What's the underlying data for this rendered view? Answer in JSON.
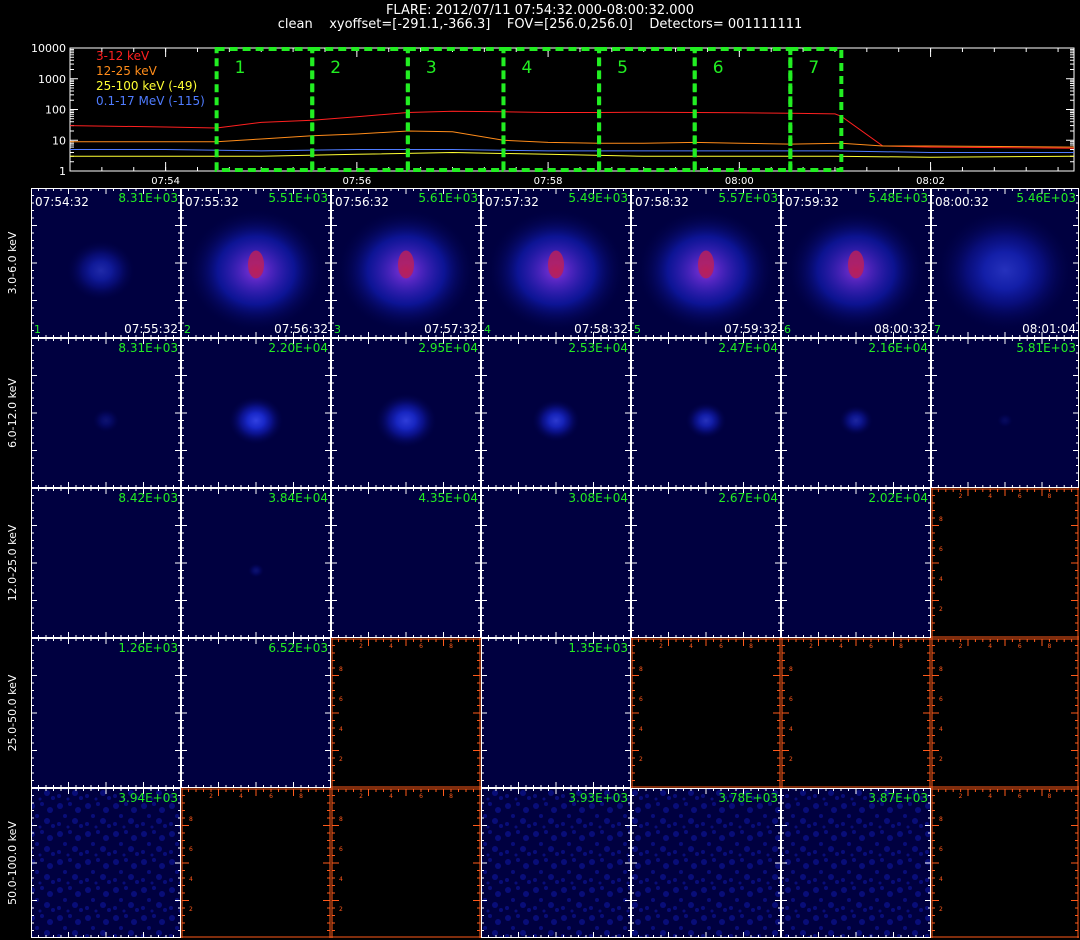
{
  "header": {
    "title": "FLARE: 2012/07/11 07:54:32.000-08:00:32.000",
    "subtitle": "clean    xyoffset=[-291.1,-366.3]    FOV=[256.0,256.0]    Detectors= 001111111"
  },
  "colors": {
    "band_3_12": "#ff2020",
    "band_12_25": "#ff8c1a",
    "band_25_100": "#ffff33",
    "band_100k": "#4f7cff",
    "box": "#22ee22",
    "peak_label": "#22ee22",
    "empty_axes": "#ff5a1a",
    "image_axes": "#ffffff"
  },
  "chart_data": [
    {
      "type": "line",
      "yscale": "log",
      "ylim": [
        1,
        10000
      ],
      "xlim": [
        "07:53:00",
        "08:03:30"
      ],
      "y_tick_labels": [
        "1",
        "10",
        "100",
        "1000",
        "10000"
      ],
      "x_tick_labels": [
        "07:54",
        "07:56",
        "07:58",
        "08:00",
        "08:02"
      ],
      "series": [
        {
          "name": "3-12 keV",
          "color": "#ff2020",
          "x": [
            "07:53:00",
            "07:54:00",
            "07:54:32",
            "07:55:00",
            "07:55:32",
            "07:56:00",
            "07:56:32",
            "07:57:00",
            "07:57:32",
            "07:58:00",
            "07:58:32",
            "07:59:00",
            "07:59:32",
            "08:00:00",
            "08:00:32",
            "08:01:00",
            "08:01:04",
            "08:01:30",
            "08:02:00",
            "08:03:30"
          ],
          "y": [
            30,
            27,
            25,
            38,
            45,
            58,
            80,
            88,
            84,
            80,
            80,
            82,
            80,
            78,
            76,
            72,
            60,
            6.5,
            6,
            5.5
          ]
        },
        {
          "name": "12-25 keV",
          "color": "#ff8c1a",
          "x": [
            "07:53:00",
            "07:54:32",
            "07:55:00",
            "07:55:32",
            "07:56:00",
            "07:56:32",
            "07:57:00",
            "07:57:32",
            "07:58:00",
            "07:58:32",
            "07:59:00",
            "07:59:32",
            "08:00:00",
            "08:00:32",
            "08:01:04",
            "08:01:30",
            "08:02:00",
            "08:03:30"
          ],
          "y": [
            9,
            9,
            11,
            14,
            16,
            20,
            19,
            10,
            8.5,
            8,
            8,
            8.5,
            8,
            7.5,
            8,
            6.5,
            6.5,
            6
          ]
        },
        {
          "name": "25-100 keV (-49)",
          "color": "#ffff33",
          "x": [
            "07:53:00",
            "07:54:00",
            "07:55:00",
            "07:56:00",
            "07:57:00",
            "07:58:00",
            "07:59:00",
            "08:00:00",
            "08:01:00",
            "08:02:00",
            "08:03:30"
          ],
          "y": [
            3,
            3,
            3,
            3.5,
            4,
            3.5,
            3,
            3,
            3,
            2.8,
            3
          ]
        },
        {
          "name": "0.1-17 MeV (-115)",
          "color": "#4f7cff",
          "x": [
            "07:53:00",
            "07:54:00",
            "07:55:00",
            "07:56:00",
            "07:57:00",
            "07:58:00",
            "07:59:00",
            "08:00:00",
            "08:01:00",
            "08:02:00",
            "08:03:30"
          ],
          "y": [
            5,
            5,
            4.5,
            5,
            5,
            4.5,
            4.5,
            4.5,
            4.5,
            4,
            4
          ]
        }
      ],
      "intervals": [
        {
          "label": "1",
          "start": "07:54:32",
          "end": "07:55:32"
        },
        {
          "label": "2",
          "start": "07:55:32",
          "end": "07:56:32"
        },
        {
          "label": "3",
          "start": "07:56:32",
          "end": "07:57:32"
        },
        {
          "label": "4",
          "start": "07:57:32",
          "end": "07:58:32"
        },
        {
          "label": "5",
          "start": "07:58:32",
          "end": "07:59:32"
        },
        {
          "label": "6",
          "start": "07:59:32",
          "end": "08:00:32"
        },
        {
          "label": "7",
          "start": "08:00:32",
          "end": "08:01:04"
        }
      ]
    },
    {
      "type": "heatmap",
      "columns": [
        {
          "index": "1",
          "start": "07:54:32",
          "end": "07:55:32"
        },
        {
          "index": "2",
          "start": "07:55:32",
          "end": "07:56:32"
        },
        {
          "index": "3",
          "start": "07:56:32",
          "end": "07:57:32"
        },
        {
          "index": "4",
          "start": "07:57:32",
          "end": "07:58:32"
        },
        {
          "index": "5",
          "start": "07:58:32",
          "end": "07:59:32"
        },
        {
          "index": "6",
          "start": "07:59:32",
          "end": "08:00:32"
        },
        {
          "index": "7",
          "start": "08:00:32",
          "end": "08:01:04"
        }
      ],
      "rows": [
        {
          "label": "3.0-6.0 keV",
          "peaks": [
            "8.31E+03",
            "5.51E+03",
            "5.61E+03",
            "5.49E+03",
            "5.57E+03",
            "5.48E+03",
            "5.46E+03"
          ],
          "intensity": [
            0.55,
            0.95,
            0.95,
            0.95,
            0.95,
            0.9,
            0.65
          ],
          "spread": [
            0.5,
            1,
            1,
            1,
            1,
            1,
            1
          ]
        },
        {
          "label": "6.0-12.0 keV",
          "peaks": [
            "8.31E+03",
            "2.20E+04",
            "2.95E+04",
            "2.53E+04",
            "2.47E+04",
            "2.16E+04",
            "5.81E+03"
          ],
          "intensity": [
            0.25,
            0.85,
            0.8,
            0.75,
            0.65,
            0.5,
            0.15
          ],
          "spread": [
            0.2,
            0.4,
            0.45,
            0.35,
            0.3,
            0.25,
            0.12
          ]
        },
        {
          "label": "12.0-25.0 keV",
          "peaks": [
            "8.42E+03",
            "3.84E+04",
            "4.35E+04",
            "3.08E+04",
            "2.67E+04",
            "2.02E+04",
            ""
          ],
          "intensity": [
            0,
            0.25,
            0,
            0,
            0,
            0,
            null
          ],
          "spread": [
            0,
            0.12,
            0,
            0,
            0,
            0,
            0
          ]
        },
        {
          "label": "25.0-50.0 keV",
          "peaks": [
            "1.26E+03",
            "6.52E+03",
            "",
            "1.35E+03",
            "",
            "",
            ""
          ],
          "intensity": [
            0,
            0,
            null,
            0,
            null,
            null,
            null
          ],
          "spread": [
            0,
            0,
            0,
            0,
            0,
            0,
            0
          ]
        },
        {
          "label": "50.0-100.0 keV",
          "peaks": [
            "3.94E+03",
            "",
            "",
            "3.93E+03",
            "3.78E+03",
            "3.87E+03",
            ""
          ],
          "intensity": [
            0.3,
            null,
            null,
            0.3,
            0.3,
            0.3,
            null
          ],
          "spread": [
            0,
            0,
            0,
            0,
            0,
            0,
            0
          ]
        }
      ],
      "empty_axis_tick_labels": [
        "2",
        "4",
        "6",
        "8"
      ]
    }
  ]
}
